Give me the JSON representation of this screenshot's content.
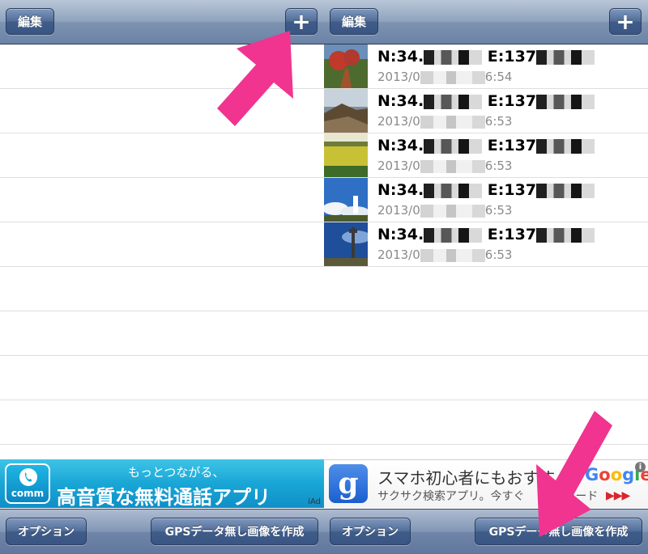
{
  "left": {
    "navbar": {
      "edit_label": "編集",
      "add_label": "+"
    },
    "ad": {
      "line1": "もっとつながる、",
      "line2": "高音質な無料通話アプリ",
      "logo_text": "comm",
      "badge": "iAd",
      "background_color": "#19a6d6"
    },
    "toolbar": {
      "options_label": "オプション",
      "make_label": "GPSデータ無し画像を作成"
    }
  },
  "right": {
    "navbar": {
      "edit_label": "編集",
      "add_label": "+"
    },
    "rows": [
      {
        "lat": "N:34.",
        "lon": "E:137",
        "date": "2013/0",
        "time": "6:54"
      },
      {
        "lat": "N:34.",
        "lon": "E:137",
        "date": "2013/0",
        "time": "6:53"
      },
      {
        "lat": "N:34.",
        "lon": "E:137",
        "date": "2013/0",
        "time": "6:53"
      },
      {
        "lat": "N:34.",
        "lon": "E:137",
        "date": "2013/0",
        "time": "6:53"
      },
      {
        "lat": "N:34.",
        "lon": "E:137",
        "date": "2013/0",
        "time": "6:53"
      }
    ],
    "ad": {
      "logo_text": "g",
      "line1": "スマホ初心者にもおすす",
      "line2": "サクサク検索アプリ。今すぐ",
      "line2_tail": "ロード",
      "arrows": "▶▶▶",
      "brand": [
        "G",
        "o",
        "o",
        "g",
        "l",
        "e"
      ],
      "info": "i"
    },
    "toolbar": {
      "options_label": "オプション",
      "make_label": "GPSデータ無し画像を作成"
    }
  },
  "colors": {
    "highlight_arrow": "#f0348f",
    "toolbar": "#6f86a9",
    "separator": "#dedede"
  }
}
